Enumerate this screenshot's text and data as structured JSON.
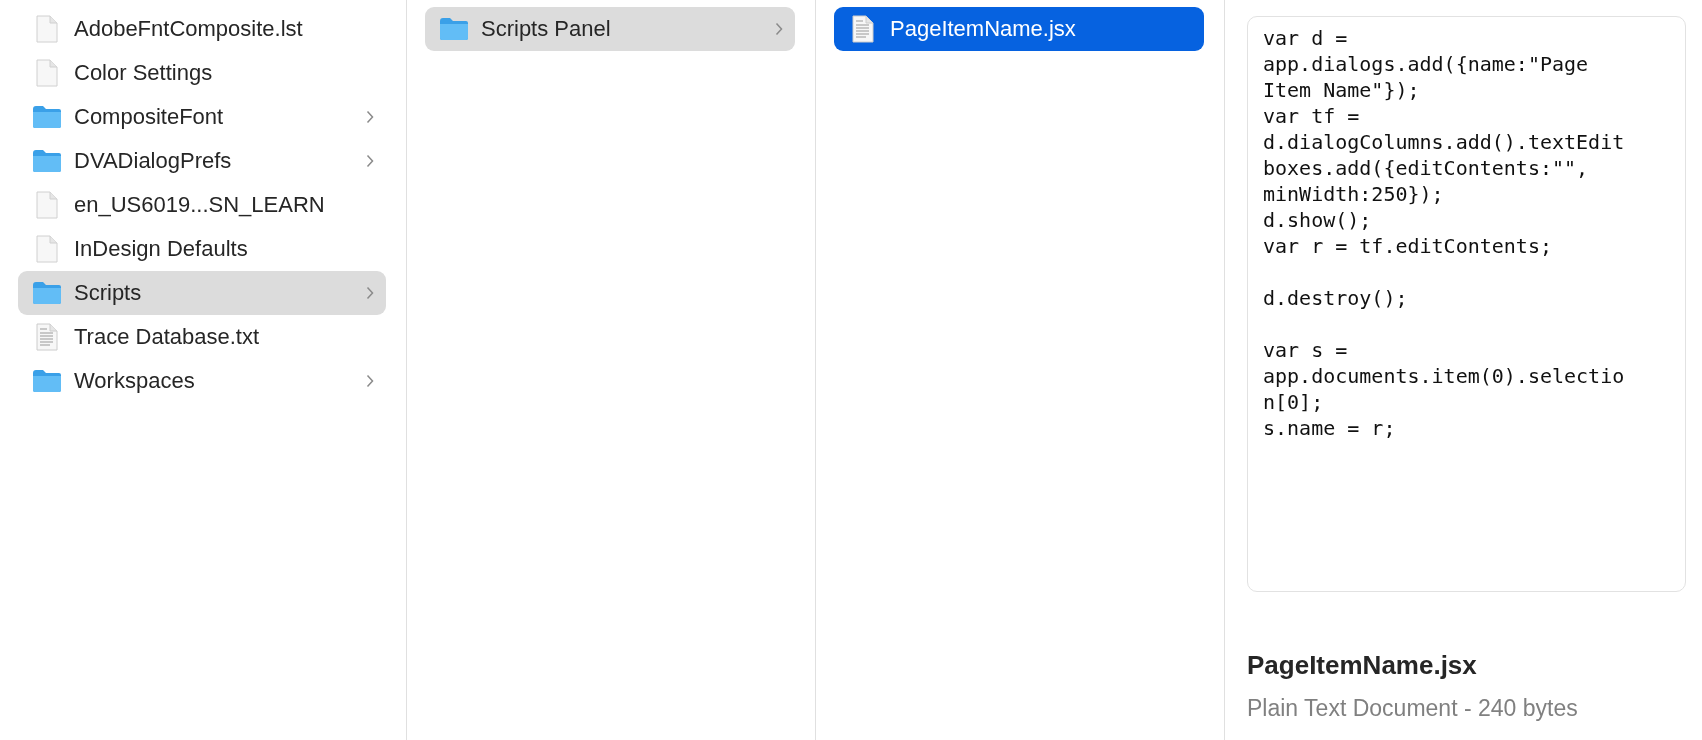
{
  "columns": [
    {
      "focused": false,
      "items": [
        {
          "name": "AdobeFntComposite.lst",
          "kind": "document",
          "expandable": false,
          "selected": false
        },
        {
          "name": "Color Settings",
          "kind": "document",
          "expandable": false,
          "selected": false
        },
        {
          "name": "CompositeFont",
          "kind": "folder",
          "expandable": true,
          "selected": false
        },
        {
          "name": "DVADialogPrefs",
          "kind": "folder",
          "expandable": true,
          "selected": false
        },
        {
          "name": "en_US6019...SN_LEARN",
          "kind": "document",
          "expandable": false,
          "selected": false
        },
        {
          "name": "InDesign Defaults",
          "kind": "document",
          "expandable": false,
          "selected": false
        },
        {
          "name": "Scripts",
          "kind": "folder",
          "expandable": true,
          "selected": true
        },
        {
          "name": "Trace Database.txt",
          "kind": "text_document",
          "expandable": false,
          "selected": false
        },
        {
          "name": "Workspaces",
          "kind": "folder",
          "expandable": true,
          "selected": false
        }
      ]
    },
    {
      "focused": false,
      "items": [
        {
          "name": "Scripts Panel",
          "kind": "folder",
          "expandable": true,
          "selected": true
        }
      ]
    },
    {
      "focused": true,
      "items": [
        {
          "name": "PageItemName.jsx",
          "kind": "text_document",
          "expandable": false,
          "selected": true
        }
      ]
    }
  ],
  "preview": {
    "content": "var d =\napp.dialogs.add({name:\"Page\nItem Name\"});\nvar tf =\nd.dialogColumns.add().textEdit\nboxes.add({editContents:\"\",\nminWidth:250});\nd.show();\nvar r = tf.editContents;\n\nd.destroy();\n\nvar s =\napp.documents.item(0).selectio\nn[0];\ns.name = r;",
    "file_name": "PageItemName.jsx",
    "file_info": "Plain Text Document - 240 bytes"
  }
}
